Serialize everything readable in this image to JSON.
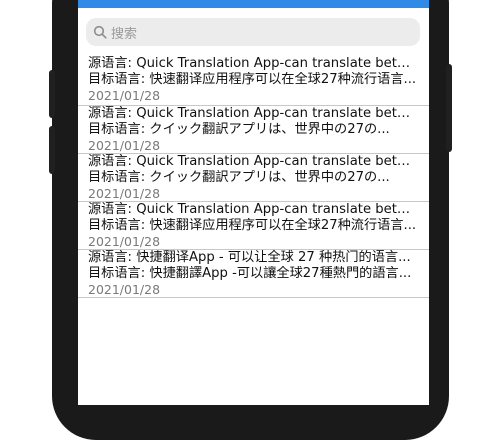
{
  "search": {
    "placeholder": "搜索"
  },
  "items": [
    {
      "source": "源语言: Quick Translation App-can translate between...",
      "target": "目标语言: 快速翻译应用程序可以在全球27种流行语言...",
      "date": "2021/01/28"
    },
    {
      "source": "源语言: Quick Translation App-can translate between...",
      "target": "目标语言: クイック翻訳アプリは、世界中の27の...",
      "date": "2021/01/28"
    },
    {
      "source": "源语言: Quick Translation App-can translate between...",
      "target": "目标语言: クイック翻訳アプリは、世界中の27の...",
      "date": "2021/01/28"
    },
    {
      "source": "源语言: Quick Translation App-can translate between...",
      "target": "目标语言: 快速翻译应用程序可以在全球27种流行语言...",
      "date": "2021/01/28"
    },
    {
      "source": "源语言: 快捷翻译App - 可以让全球 27 种热门的语言...",
      "target": "目标语言: 快捷翻譯App -可以讓全球27種熱門的語言...",
      "date": "2021/01/28"
    }
  ],
  "colors": {
    "accent": "#2f8be6",
    "phone_frame": "#1a1a1a"
  }
}
